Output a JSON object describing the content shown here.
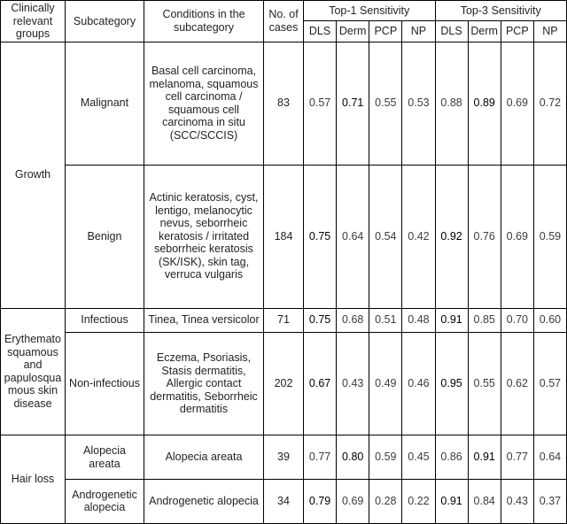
{
  "table": {
    "headers": {
      "group": "Clinically relevant groups",
      "subcategory": "Subcategory",
      "conditions": "Conditions in the subcategory",
      "cases": "No. of cases",
      "top1": "Top-1 Sensitivity",
      "top3": "Top-3 Sensitivity",
      "raters": [
        "DLS",
        "Derm",
        "PCP",
        "NP"
      ]
    },
    "groups": [
      {
        "name": "Growth",
        "rows": [
          {
            "subcategory": "Malignant",
            "conditions": "Basal cell carcinoma, melanoma, squamous cell carcinoma / squamous cell carcinoma in situ (SCC/SCCIS)",
            "cases": "83",
            "top1": [
              "0.57",
              "0.71",
              "0.55",
              "0.53"
            ],
            "top1_best": [
              false,
              true,
              false,
              false
            ],
            "top3": [
              "0.88",
              "0.89",
              "0.69",
              "0.72"
            ],
            "top3_best": [
              false,
              true,
              false,
              false
            ]
          },
          {
            "subcategory": "Benign",
            "conditions": "Actinic keratosis, cyst, lentigo, melanocytic nevus, seborrheic keratosis / irritated seborrheic keratosis (SK/ISK), skin tag, verruca vulgaris",
            "cases": "184",
            "top1": [
              "0.75",
              "0.64",
              "0.54",
              "0.42"
            ],
            "top1_best": [
              true,
              false,
              false,
              false
            ],
            "top3": [
              "0.92",
              "0.76",
              "0.69",
              "0.59"
            ],
            "top3_best": [
              true,
              false,
              false,
              false
            ]
          }
        ]
      },
      {
        "name": "Erythematosquamous and papulosquamous skin disease",
        "rows": [
          {
            "subcategory": "Infectious",
            "conditions": "Tinea, Tinea versicolor",
            "cases": "71",
            "top1": [
              "0.75",
              "0.68",
              "0.51",
              "0.48"
            ],
            "top1_best": [
              true,
              false,
              false,
              false
            ],
            "top3": [
              "0.91",
              "0.85",
              "0.70",
              "0.60"
            ],
            "top3_best": [
              true,
              false,
              false,
              false
            ]
          },
          {
            "subcategory": "Non-infectious",
            "conditions": "Eczema, Psoriasis, Stasis dermatitis, Allergic contact dermatitis, Seborrheic dermatitis",
            "cases": "202",
            "top1": [
              "0.67",
              "0.43",
              "0.49",
              "0.46"
            ],
            "top1_best": [
              true,
              false,
              false,
              false
            ],
            "top3": [
              "0.95",
              "0.55",
              "0.62",
              "0.57"
            ],
            "top3_best": [
              true,
              false,
              false,
              false
            ]
          }
        ]
      },
      {
        "name": "Hair loss",
        "rows": [
          {
            "subcategory": "Alopecia areata",
            "conditions": "Alopecia areata",
            "cases": "39",
            "top1": [
              "0.77",
              "0.80",
              "0.59",
              "0.45"
            ],
            "top1_best": [
              false,
              true,
              false,
              false
            ],
            "top3": [
              "0.86",
              "0.91",
              "0.77",
              "0.64"
            ],
            "top3_best": [
              false,
              true,
              false,
              false
            ]
          },
          {
            "subcategory": "Androgenetic alopecia",
            "conditions": "Androgenetic alopecia",
            "cases": "34",
            "top1": [
              "0.79",
              "0.69",
              "0.28",
              "0.22"
            ],
            "top1_best": [
              true,
              false,
              false,
              false
            ],
            "top3": [
              "0.91",
              "0.84",
              "0.43",
              "0.37"
            ],
            "top3_best": [
              true,
              false,
              false,
              false
            ]
          }
        ]
      }
    ]
  }
}
